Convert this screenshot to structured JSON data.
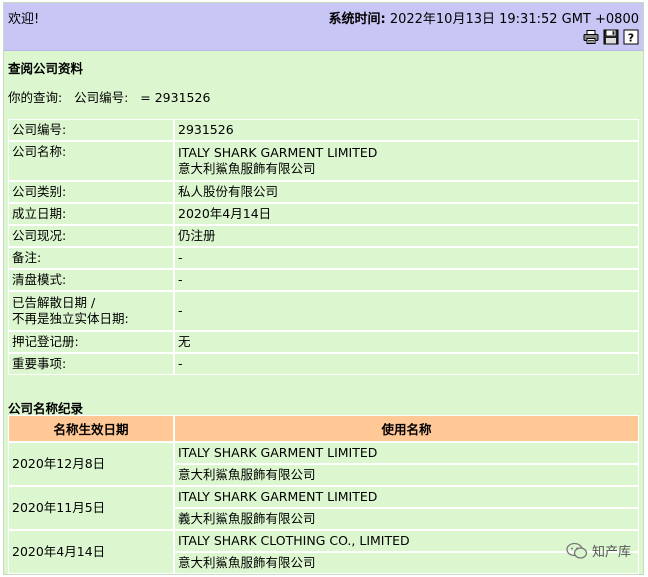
{
  "header": {
    "welcome": "欢迎!",
    "systime_label": "系统时间:",
    "systime_value": "2022年10月13日 19:31:52 GMT +0800",
    "tools": [
      "printer-icon",
      "save-icon",
      "help-icon"
    ]
  },
  "page_title": "查阅公司资料",
  "query": {
    "label": "你的查询:",
    "field": "公司编号:",
    "value": "= 2931526"
  },
  "info_rows": [
    {
      "label": "公司编号:",
      "value": "2931526"
    },
    {
      "label": "公司名称:",
      "value": "ITALY SHARK GARMENT LIMITED",
      "value2": "意大利鯊魚服飾有限公司"
    },
    {
      "label": "公司类别:",
      "value": "私人股份有限公司"
    },
    {
      "label": "成立日期:",
      "value": "2020年4月14日"
    },
    {
      "label": "公司现况:",
      "value": "仍注册"
    },
    {
      "label": "备注:",
      "value": "-"
    },
    {
      "label": "清盘模式:",
      "value": "-"
    },
    {
      "label": "已告解散日期 /",
      "label2": "不再是独立实体日期:",
      "value": "-"
    },
    {
      "label": "押记登记册:",
      "value": "无"
    },
    {
      "label": "重要事项:",
      "value": "-"
    }
  ],
  "name_history": {
    "title": "公司名称纪录",
    "col_date": "名称生效日期",
    "col_name": "使用名称",
    "rows": [
      {
        "date": "2020年12月8日",
        "name_en": "ITALY SHARK GARMENT LIMITED",
        "name_zh": "意大利鯊魚服飾有限公司"
      },
      {
        "date": "2020年11月5日",
        "name_en": "ITALY SHARK GARMENT LIMITED",
        "name_zh": "義大利鯊魚服飾有限公司"
      },
      {
        "date": "2020年4月14日",
        "name_en": "ITALY SHARK CLOTHING CO., LIMITED",
        "name_zh": "意大利鯊魚服飾有限公司"
      }
    ]
  },
  "watermark": "知产库"
}
